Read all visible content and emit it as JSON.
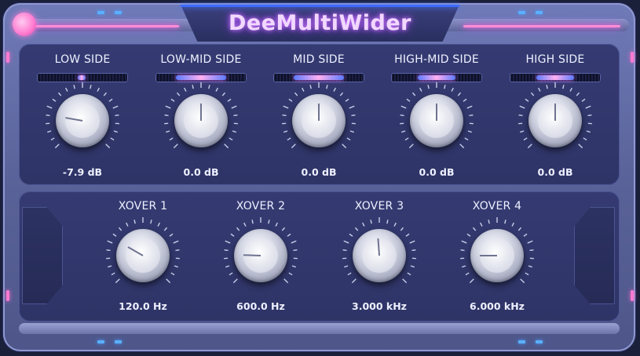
{
  "app": {
    "title": "DeeMultiWider"
  },
  "colors": {
    "accent_pink": "#ff7ad0",
    "accent_blue": "#4a7aff",
    "panel": "#2e3466",
    "text": "#eef0ff"
  },
  "icons": {
    "power": "power-button"
  },
  "bands": [
    {
      "label": "LOW SIDE",
      "value": "-7.9 dB",
      "knob_angle_deg": -80
    },
    {
      "label": "LOW-MID SIDE",
      "value": "0.0 dB",
      "knob_angle_deg": 0
    },
    {
      "label": "MID SIDE",
      "value": "0.0 dB",
      "knob_angle_deg": 0
    },
    {
      "label": "HIGH-MID SIDE",
      "value": "0.0 dB",
      "knob_angle_deg": 0
    },
    {
      "label": "HIGH SIDE",
      "value": "0.0 dB",
      "knob_angle_deg": 0
    }
  ],
  "crossovers": [
    {
      "label": "XOVER 1",
      "value": "120.0 Hz",
      "knob_angle_deg": -60
    },
    {
      "label": "XOVER 2",
      "value": "600.0 Hz",
      "knob_angle_deg": -88
    },
    {
      "label": "XOVER 3",
      "value": "3.000 kHz",
      "knob_angle_deg": -4
    },
    {
      "label": "XOVER 4",
      "value": "6.000 kHz",
      "knob_angle_deg": -90
    }
  ]
}
